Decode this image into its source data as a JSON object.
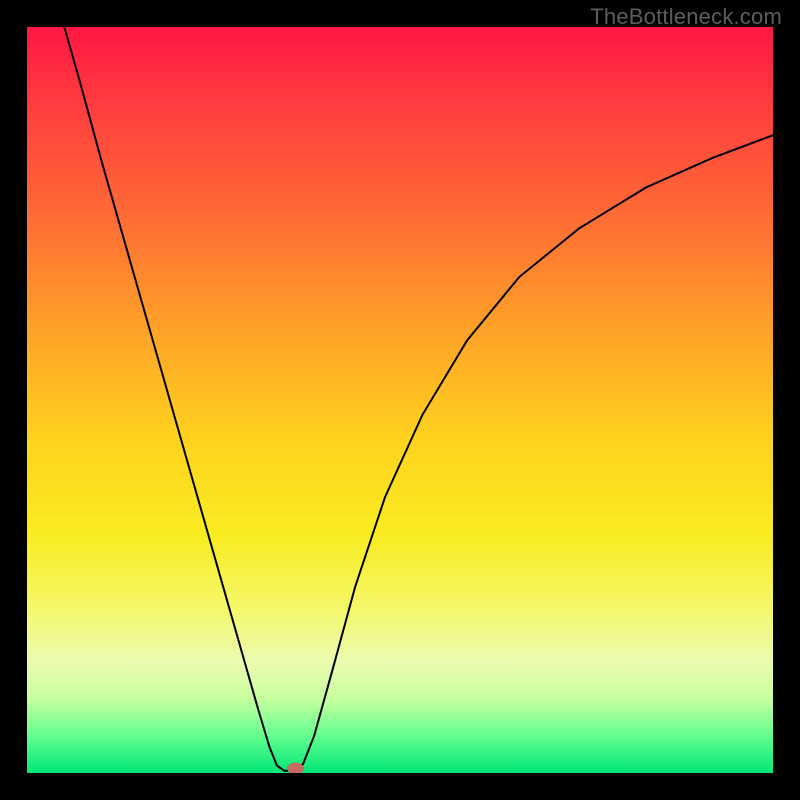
{
  "watermark": "TheBottleneck.com",
  "chart_data": {
    "type": "line",
    "title": "",
    "xlabel": "",
    "ylabel": "",
    "xlim": [
      0,
      100
    ],
    "ylim": [
      0,
      100
    ],
    "gradient_stops": [
      {
        "offset": 0,
        "color": "#ff1744"
      },
      {
        "offset": 10,
        "color": "#ff3b3f"
      },
      {
        "offset": 25,
        "color": "#ff6a35"
      },
      {
        "offset": 40,
        "color": "#ffa028"
      },
      {
        "offset": 55,
        "color": "#ffd21f"
      },
      {
        "offset": 68,
        "color": "#f9ec20"
      },
      {
        "offset": 78,
        "color": "#f4f86a"
      },
      {
        "offset": 85,
        "color": "#ecfcb0"
      },
      {
        "offset": 90,
        "color": "#c7ff9e"
      },
      {
        "offset": 95,
        "color": "#63ff8f"
      },
      {
        "offset": 100,
        "color": "#00e676"
      }
    ],
    "series": [
      {
        "name": "curve",
        "points": [
          {
            "x": 5.0,
            "y": 100.0
          },
          {
            "x": 7.0,
            "y": 93.0
          },
          {
            "x": 10.0,
            "y": 82.0
          },
          {
            "x": 14.0,
            "y": 68.0
          },
          {
            "x": 18.0,
            "y": 54.0
          },
          {
            "x": 22.0,
            "y": 40.0
          },
          {
            "x": 26.0,
            "y": 26.0
          },
          {
            "x": 29.0,
            "y": 15.5
          },
          {
            "x": 31.0,
            "y": 8.5
          },
          {
            "x": 32.5,
            "y": 3.5
          },
          {
            "x": 33.5,
            "y": 1.0
          },
          {
            "x": 34.5,
            "y": 0.3
          },
          {
            "x": 36.0,
            "y": 0.3
          },
          {
            "x": 37.0,
            "y": 1.2
          },
          {
            "x": 38.5,
            "y": 5.0
          },
          {
            "x": 41.0,
            "y": 14.0
          },
          {
            "x": 44.0,
            "y": 25.0
          },
          {
            "x": 48.0,
            "y": 37.0
          },
          {
            "x": 53.0,
            "y": 48.0
          },
          {
            "x": 59.0,
            "y": 58.0
          },
          {
            "x": 66.0,
            "y": 66.5
          },
          {
            "x": 74.0,
            "y": 73.0
          },
          {
            "x": 83.0,
            "y": 78.5
          },
          {
            "x": 92.0,
            "y": 82.5
          },
          {
            "x": 100.0,
            "y": 85.5
          }
        ]
      }
    ],
    "marker": {
      "x": 36.0,
      "y": 0.0,
      "color": "#c56b5d"
    }
  }
}
